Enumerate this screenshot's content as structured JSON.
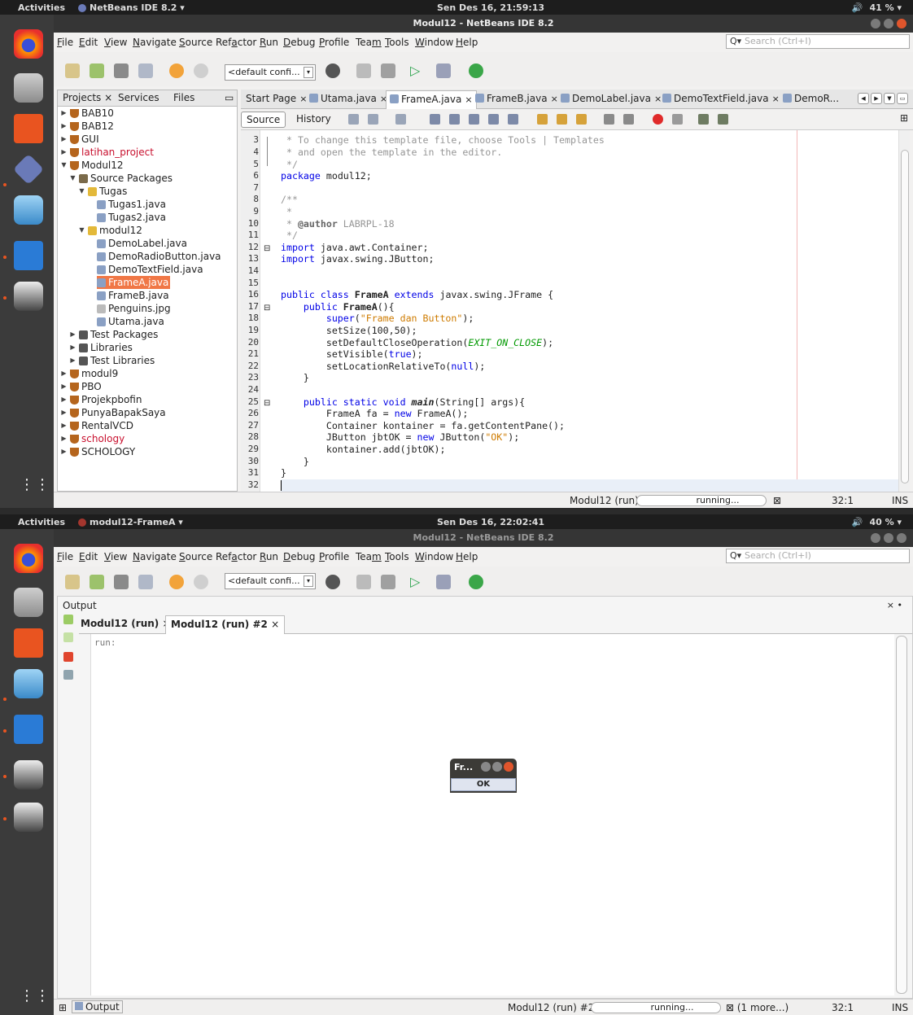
{
  "s1": {
    "topbar": {
      "activities": "Activities",
      "app": "NetBeans IDE 8.2 ▾",
      "clock": "Sen Des 16, 21:59:13",
      "volume": "🔊",
      "battery": "41 % ▾"
    },
    "title": "Modul12 - NetBeans IDE 8.2",
    "search_placeholder": "Search (Ctrl+I)",
    "config": "<default confi...",
    "project_tabs": [
      "Projects ×",
      "Services",
      "Files"
    ],
    "tree": [
      "BAB10",
      "BAB12",
      "GUI",
      "latihan_project",
      "Modul12",
      "Source Packages",
      "Tugas",
      "Tugas1.java",
      "Tugas2.java",
      "modul12",
      "DemoLabel.java",
      "DemoRadioButton.java",
      "DemoTextField.java",
      "FrameA.java",
      "FrameB.java",
      "Penguins.jpg",
      "Utama.java",
      "Test Packages",
      "Libraries",
      "Test Libraries",
      "modul9",
      "PBO",
      "Projekpbofin",
      "PunyaBapakSaya",
      "RentalVCD",
      "schology",
      "SCHOLOGY"
    ],
    "editor_tabs": [
      "Start Page",
      "Utama.java",
      "FrameA.java",
      "FrameB.java",
      "DemoLabel.java",
      "DemoTextField.java",
      "DemoR..."
    ],
    "source_label": "Source",
    "history_label": "History",
    "line_numbers": [
      "3",
      "4",
      "5",
      "6",
      "7",
      "8",
      "9",
      "10",
      "11",
      "12",
      "13",
      "14",
      "15",
      "16",
      "17",
      "18",
      "19",
      "20",
      "21",
      "22",
      "23",
      "24",
      "25",
      "26",
      "27",
      "28",
      "29",
      "30",
      "31",
      "32"
    ],
    "code": {
      "l3": " * To change this template file, choose Tools | Templates",
      "l4": " * and open the template in the editor.",
      "l5": " */",
      "l6_kw": "package",
      "l6_rest": " modul12;",
      "l8": "/**",
      "l9": " *",
      "l10_a": " * ",
      "l10_tag": "@author",
      "l10_b": " LABRPL-18",
      "l11": " */",
      "l12_kw": "import",
      "l12_rest": " java.awt.Container;",
      "l13_kw": "import",
      "l13_rest": " javax.swing.JButton;",
      "l16_kw": "public class",
      "l16_name": " FrameA ",
      "l16_kw2": "extends",
      "l16_rest": " javax.swing.JFrame {",
      "l17_kw": "    public",
      "l17_name": " FrameA",
      "l17_rest": "(){",
      "l18_kw": "        super",
      "l18_a": "(",
      "l18_str": "\"Frame dan Button\"",
      "l18_b": ");",
      "l19_a": "        setSize(100,50);",
      "l20_a": "        setDefaultCloseOperation(",
      "l20_it": "EXIT_ON_CLOSE",
      "l20_b": ");",
      "l21_a": "        setVisible(",
      "l21_kw": "true",
      "l21_b": ");",
      "l22_a": "        setLocationRelativeTo(",
      "l22_kw": "null",
      "l22_b": ");",
      "l23": "    }",
      "l25_kw": "    public static void",
      "l25_name": " main",
      "l25_rest": "(String[] args){",
      "l26_a": "        FrameA fa = ",
      "l26_kw": "new",
      "l26_b": " FrameA();",
      "l27": "        Container kontainer = fa.getContentPane();",
      "l28_a": "        JButton jbtOK = ",
      "l28_kw": "new",
      "l28_b": " JButton(",
      "l28_str": "\"OK\"",
      "l28_c": ");",
      "l29": "        kontainer.add(jbtOK);",
      "l30": "    }",
      "l31": "}"
    },
    "status": {
      "run": "Modul12 (run)",
      "running": "running...",
      "pos": "32:1",
      "ins": "INS"
    }
  },
  "s2": {
    "topbar": {
      "activities": "Activities",
      "app": "modul12-FrameA ▾",
      "clock": "Sen Des 16, 22:02:41",
      "volume": "🔊",
      "battery": "40 % ▾"
    },
    "title": "Modul12 - NetBeans IDE 8.2",
    "search_placeholder": "Search (Ctrl+I)",
    "config": "<default confi...",
    "output_title": "Output",
    "output_tabs": [
      "Modul12 (run)",
      "Modul12 (run) #2"
    ],
    "run_text": "run:",
    "frame_title": "Fr...",
    "ok_label": "OK",
    "status": {
      "output_tab": "Output",
      "run": "Modul12 (run) #2",
      "running": "running...",
      "more": "(1 more...)",
      "pos": "32:1",
      "ins": "INS"
    }
  },
  "menu": [
    {
      "pre": "",
      "u": "F",
      "post": "ile"
    },
    {
      "pre": "",
      "u": "E",
      "post": "dit"
    },
    {
      "pre": "",
      "u": "V",
      "post": "iew"
    },
    {
      "pre": "",
      "u": "N",
      "post": "avigate"
    },
    {
      "pre": "",
      "u": "S",
      "post": "ource"
    },
    {
      "pre": "Ref",
      "u": "a",
      "post": "ctor"
    },
    {
      "pre": "",
      "u": "R",
      "post": "un"
    },
    {
      "pre": "",
      "u": "D",
      "post": "ebug"
    },
    {
      "pre": "",
      "u": "P",
      "post": "rofile"
    },
    {
      "pre": "Tea",
      "u": "m",
      "post": ""
    },
    {
      "pre": "",
      "u": "T",
      "post": "ools"
    },
    {
      "pre": "",
      "u": "W",
      "post": "indow"
    },
    {
      "pre": "",
      "u": "H",
      "post": "elp"
    }
  ],
  "colors": {
    "accent": "#f07746",
    "keyword": "#0000e6",
    "string": "#ce7b00",
    "comment": "#969696",
    "ubuntu": "#e95420"
  }
}
